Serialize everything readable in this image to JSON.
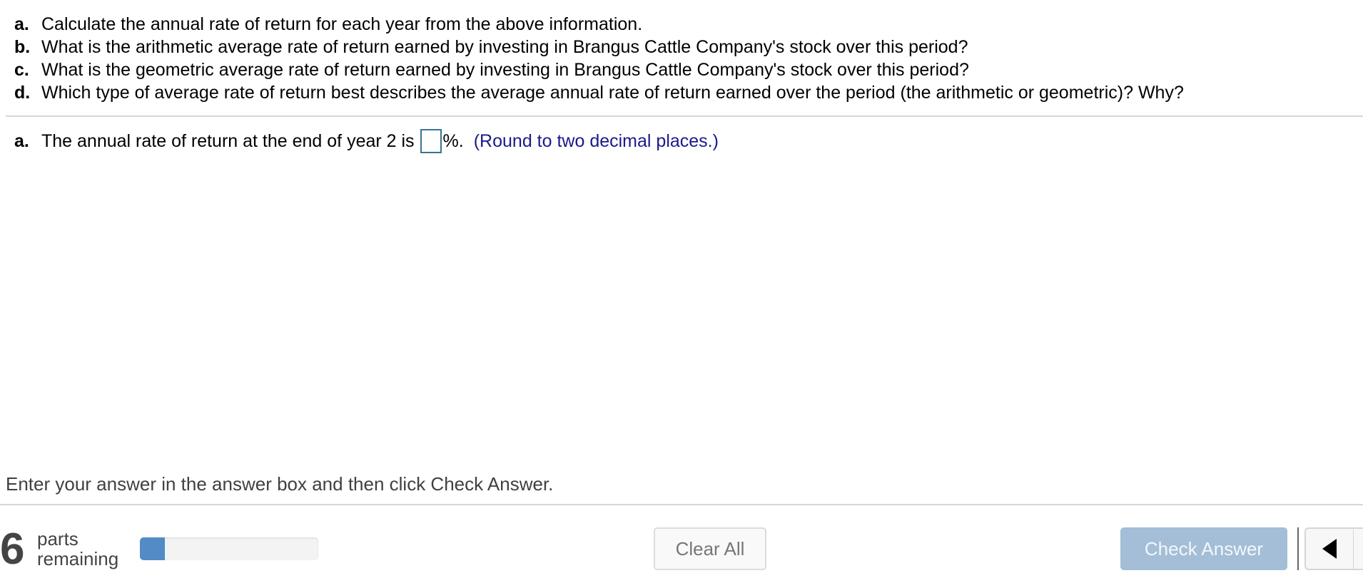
{
  "questions": [
    {
      "letter": "a.",
      "text": "Calculate the annual rate of return for each year from the above information."
    },
    {
      "letter": "b.",
      "text": "What is the arithmetic average rate of return earned by investing in Brangus Cattle Company's stock over this period?"
    },
    {
      "letter": "c.",
      "text": "What is the geometric average rate of return earned by investing in Brangus Cattle Company's stock over this period?"
    },
    {
      "letter": "d.",
      "text": "Which type of average rate of return best describes the average annual rate of return earned over the period (the arithmetic or geometric)?  Why?"
    }
  ],
  "answer": {
    "letter": "a.",
    "prefix": "The annual rate of return at the end of year 2 is",
    "input_value": "",
    "suffix": "%.",
    "hint": "(Round to two decimal places.)"
  },
  "instructions": "Enter your answer in the answer box and then click Check Answer.",
  "footer": {
    "parts_count": "6",
    "parts_label_line1": "parts",
    "parts_label_line2": "remaining",
    "progress_percent": 14,
    "clear_all_label": "Clear All",
    "check_answer_label": "Check Answer",
    "prev_icon": "triangle-left"
  },
  "colors": {
    "progress_fill": "#528bc5",
    "check_button_bg": "#a3bed6",
    "hint_text": "#1a1a8c",
    "input_border": "#3a7590"
  }
}
